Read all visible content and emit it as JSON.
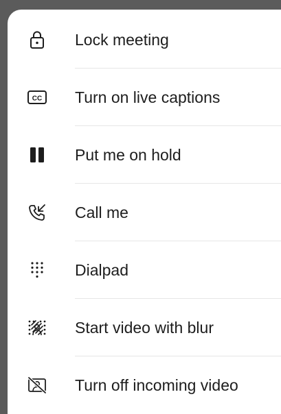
{
  "menu": {
    "items": [
      {
        "label": "Lock meeting",
        "icon": "lock-icon"
      },
      {
        "label": "Turn on live captions",
        "icon": "closed-captions-icon"
      },
      {
        "label": "Put me on hold",
        "icon": "pause-icon"
      },
      {
        "label": "Call me",
        "icon": "call-me-icon"
      },
      {
        "label": "Dialpad",
        "icon": "dialpad-icon"
      },
      {
        "label": "Start video with blur",
        "icon": "blur-background-icon"
      },
      {
        "label": "Turn off incoming video",
        "icon": "incoming-video-off-icon"
      }
    ]
  },
  "colors": {
    "backdrop": "#5b5b5b",
    "sheet": "#ffffff",
    "text": "#1d1d1d",
    "icon": "#1d1d1d",
    "divider": "#e6e6e6"
  }
}
